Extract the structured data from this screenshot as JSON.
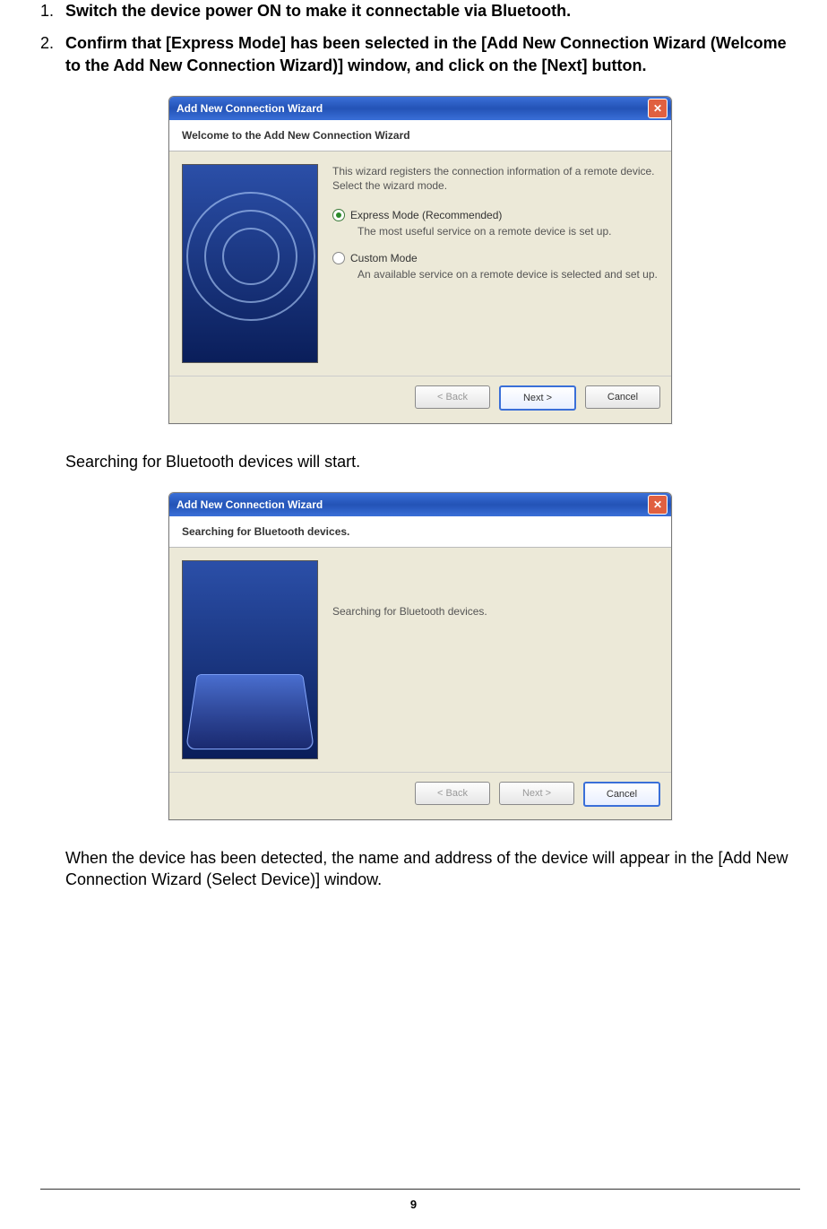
{
  "steps": {
    "s1_num": "1.",
    "s1_text": "Switch the device power ON to make it connectable via Bluetooth.",
    "s2_num": "2.",
    "s2_text": "Confirm that [Express Mode] has been selected in the [Add New Connection Wizard (Welcome to the Add New Connection Wizard)] window, and click on the [Next] button."
  },
  "body": {
    "searching_intro": "Searching for Bluetooth devices will start.",
    "detected_result": "When the device has been detected, the name and address of the device will appear in the [Add New Connection Wizard (Select Device)] window."
  },
  "wizard1": {
    "title": "Add New Connection Wizard",
    "header": "Welcome to the Add New Connection Wizard",
    "desc1": "This wizard registers the connection information of a remote device.",
    "desc2": "Select the wizard mode.",
    "opt1_label": "Express Mode (Recommended)",
    "opt1_sub": "The most useful service on a remote device is set up.",
    "opt2_label": "Custom Mode",
    "opt2_sub": "An available service on a remote device is selected and set up.",
    "back": "< Back",
    "next": "Next >",
    "cancel": "Cancel",
    "close_glyph": "✕"
  },
  "wizard2": {
    "title": "Add New Connection Wizard",
    "header": "Searching for Bluetooth devices.",
    "message": "Searching for Bluetooth devices.",
    "back": "< Back",
    "next": "Next >",
    "cancel": "Cancel",
    "close_glyph": "✕"
  },
  "page_number": "9"
}
